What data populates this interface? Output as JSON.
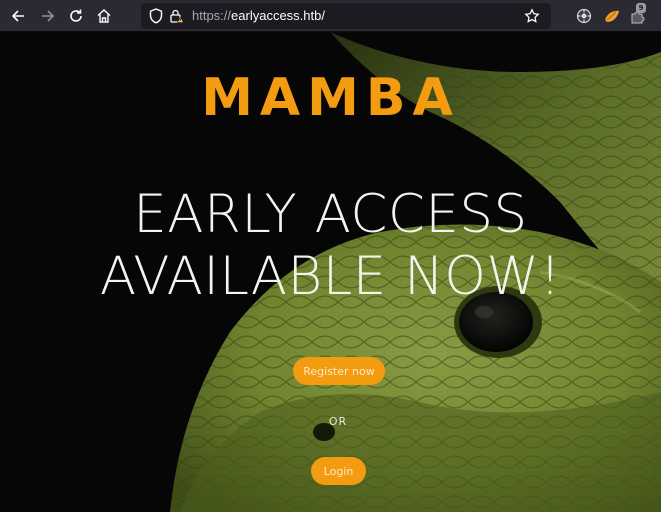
{
  "browser": {
    "url_scheme": "https://",
    "url_host": "earlyaccess.htb/",
    "extension_badge": "9",
    "icons": [
      "back-arrow-icon",
      "forward-arrow-icon",
      "reload-icon",
      "home-icon",
      "shield-icon",
      "lock-warning-icon",
      "bookmark-star-icon",
      "extension-icon",
      "fox-extension-icon",
      "puzzle-extension-icon"
    ]
  },
  "hero": {
    "logo": "MAMBA",
    "headline_line1": "EARLY ACCESS",
    "headline_line2": "AVAILABLE NOW!",
    "register_label": "Register now",
    "or_label": "OR",
    "login_label": "Login"
  },
  "colors": {
    "accent": "#f39c12",
    "toolbar": "#2b2a33",
    "urlbar": "#1c1b22",
    "headline": "#f4f4ee",
    "background": "#070807",
    "snake_green": "#8fa83c"
  }
}
